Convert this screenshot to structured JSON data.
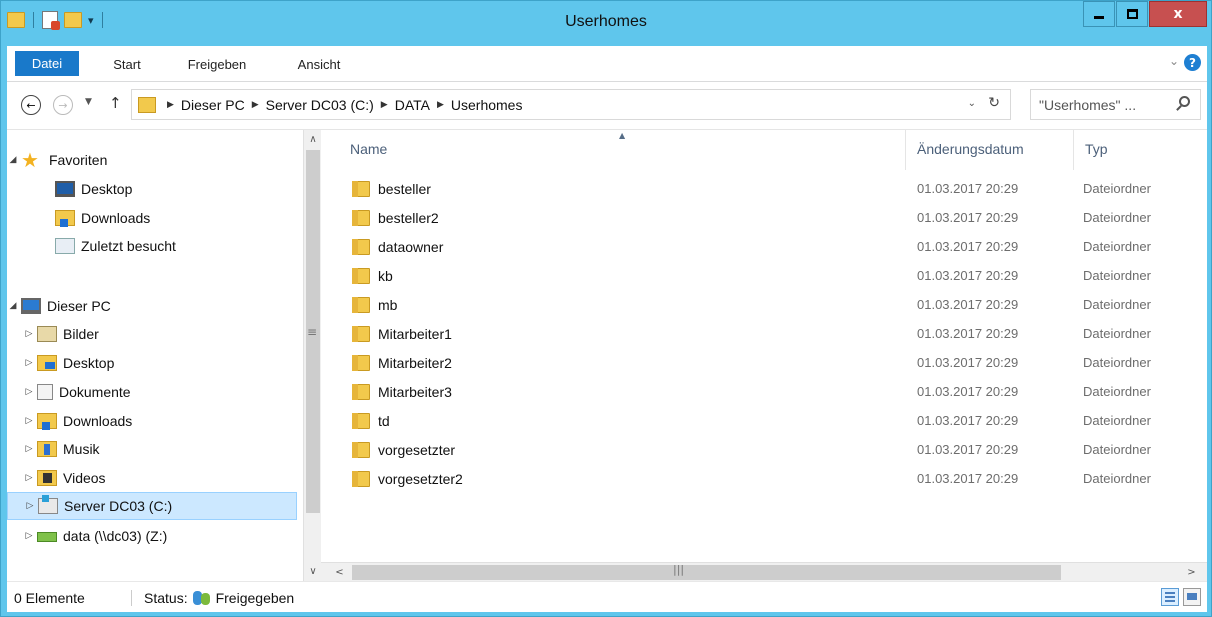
{
  "window": {
    "title": "Userhomes"
  },
  "ribbon": {
    "tabs": [
      "Datei",
      "Start",
      "Freigeben",
      "Ansicht"
    ],
    "help_label": "?"
  },
  "address": {
    "crumbs": [
      "Dieser PC",
      "Server DC03 (C:)",
      "DATA",
      "Userhomes"
    ],
    "search_placeholder": "\"Userhomes\" ..."
  },
  "navpane": {
    "favorites": {
      "label": "Favoriten",
      "items": [
        "Desktop",
        "Downloads",
        "Zuletzt besucht"
      ]
    },
    "this_pc": {
      "label": "Dieser PC",
      "items": [
        "Bilder",
        "Desktop",
        "Dokumente",
        "Downloads",
        "Musik",
        "Videos",
        "Server DC03 (C:)",
        "data (\\\\dc03) (Z:)"
      ],
      "selected": "Server DC03 (C:)"
    }
  },
  "columns": {
    "name": "Name",
    "date": "Änderungsdatum",
    "type": "Typ"
  },
  "files": [
    {
      "name": "besteller",
      "date": "01.03.2017 20:29",
      "type": "Dateiordner"
    },
    {
      "name": "besteller2",
      "date": "01.03.2017 20:29",
      "type": "Dateiordner"
    },
    {
      "name": "dataowner",
      "date": "01.03.2017 20:29",
      "type": "Dateiordner"
    },
    {
      "name": "kb",
      "date": "01.03.2017 20:29",
      "type": "Dateiordner"
    },
    {
      "name": "mb",
      "date": "01.03.2017 20:29",
      "type": "Dateiordner"
    },
    {
      "name": "Mitarbeiter1",
      "date": "01.03.2017 20:29",
      "type": "Dateiordner"
    },
    {
      "name": "Mitarbeiter2",
      "date": "01.03.2017 20:29",
      "type": "Dateiordner"
    },
    {
      "name": "Mitarbeiter3",
      "date": "01.03.2017 20:29",
      "type": "Dateiordner"
    },
    {
      "name": "td",
      "date": "01.03.2017 20:29",
      "type": "Dateiordner"
    },
    {
      "name": "vorgesetzter",
      "date": "01.03.2017 20:29",
      "type": "Dateiordner"
    },
    {
      "name": "vorgesetzter2",
      "date": "01.03.2017 20:29",
      "type": "Dateiordner"
    }
  ],
  "statusbar": {
    "count": "0 Elemente",
    "status_label": "Status:",
    "status_value": "Freigegeben"
  },
  "colors": {
    "titlebar": "#5fc6ec",
    "file_tab": "#1979ca",
    "close_button": "#c75050",
    "folder": "#f2c94c",
    "selection": "#cce8ff"
  }
}
